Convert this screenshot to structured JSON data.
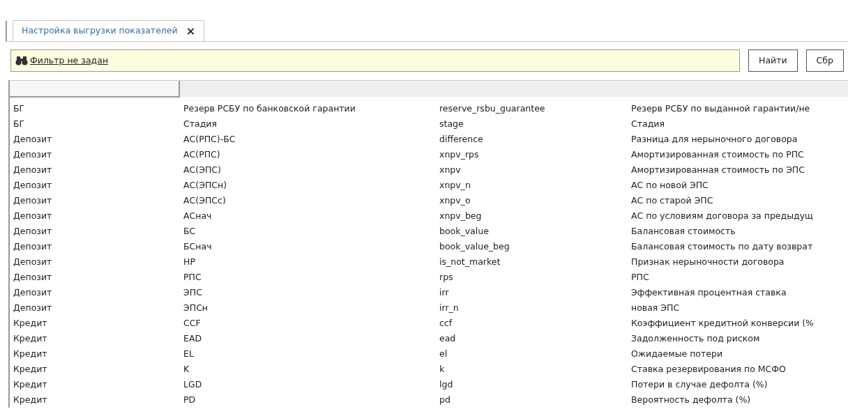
{
  "tab": {
    "label": "Настройка выгрузки показателей",
    "close": "×",
    "selected": true
  },
  "filter": {
    "label": "Фильтр не задан",
    "buttons": [
      "Найти",
      "Сбр"
    ]
  },
  "rows": [
    [
      "БГ",
      "Резерв РСБУ по банковской гарантии",
      "reserve_rsbu_guarantee",
      "Резерв РСБУ по выданной гарантии/не"
    ],
    [
      "БГ",
      "Стадия",
      "stage",
      "Стадия"
    ],
    [
      "Депозит",
      "АС(РПС)-БС",
      "difference",
      "Разница для нерыночного договора"
    ],
    [
      "Депозит",
      "АС(РПС)",
      "xnpv_rps",
      "Амортизированная стоимость по РПС"
    ],
    [
      "Депозит",
      "АС(ЭПС)",
      "xnpv",
      "Амортизированная стоимость по ЭПС"
    ],
    [
      "Депозит",
      "АС(ЭПСн)",
      "xnpv_n",
      "АС по новой ЭПС"
    ],
    [
      "Депозит",
      "АС(ЭПСс)",
      "xnpv_o",
      "АС по старой ЭПС"
    ],
    [
      "Депозит",
      "АСнач",
      "xnpv_beg",
      "АС по условиям договора за предыдущ"
    ],
    [
      "Депозит",
      "БС",
      "book_value",
      "Балансовая стоимость"
    ],
    [
      "Депозит",
      "БСнач",
      "book_value_beg",
      "Балансовая стоимость по дату возврат"
    ],
    [
      "Депозит",
      "НР",
      "is_not_market",
      "Признак нерыночности договора"
    ],
    [
      "Депозит",
      "РПС",
      "rps",
      "РПС"
    ],
    [
      "Депозит",
      "ЭПС",
      "irr",
      "Эффективная процентная ставка"
    ],
    [
      "Депозит",
      "ЭПСн",
      "irr_n",
      "новая ЭПС"
    ],
    [
      "Кредит",
      "CCF",
      "ccf",
      "Коэффициент кредитной конверсии (%"
    ],
    [
      "Кредит",
      "EAD",
      "ead",
      "Задолженность под риском"
    ],
    [
      "Кредит",
      "EL",
      "el",
      "Ожидаемые потери"
    ],
    [
      "Кредит",
      "K",
      "k",
      "Ставка резервирования по МСФО"
    ],
    [
      "Кредит",
      "LGD",
      "lgd",
      "Потери в случае дефолта (%)"
    ],
    [
      "Кредит",
      "PD",
      "pd",
      "Вероятность дефолта (%)"
    ]
  ]
}
